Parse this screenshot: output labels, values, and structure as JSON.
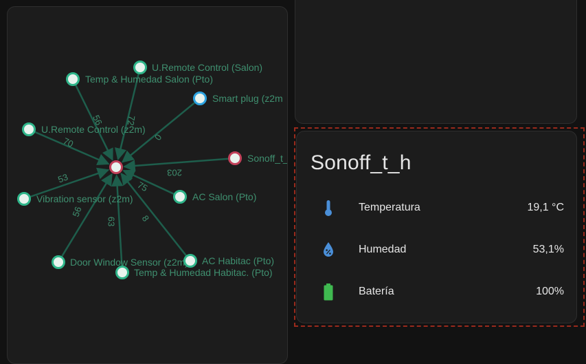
{
  "network_map": {
    "nodes": [
      {
        "id": "center",
        "label": "",
        "color": "#c2415a"
      },
      {
        "id": "u-remote-salon",
        "label": "U.Remote Control (Salon)",
        "color": "#2fb58a"
      },
      {
        "id": "temp-humedad-salon",
        "label": "Temp & Humedad Salon (Pto)",
        "color": "#2fb58a"
      },
      {
        "id": "smart-plug",
        "label": "Smart plug (z2m",
        "color": "#2da3e0"
      },
      {
        "id": "u-remote-z2m",
        "label": "U.Remote Control (z2m)",
        "color": "#2fb58a"
      },
      {
        "id": "sonoff",
        "label": "Sonoff_t_",
        "color": "#c2415a"
      },
      {
        "id": "vibration",
        "label": "Vibration sensor (z2m)",
        "color": "#2fb58a"
      },
      {
        "id": "ac-salon",
        "label": "AC Salon (Pto)",
        "color": "#2fb58a"
      },
      {
        "id": "door-window",
        "label": "Door Window Sensor (z2m)",
        "color": "#2fb58a"
      },
      {
        "id": "ac-habitac",
        "label": "AC Habitac (Pto)",
        "color": "#2fb58a"
      },
      {
        "id": "temp-humedad-habitac",
        "label": "Temp & Humedad Habitac. (Pto)",
        "color": "#2fb58a"
      }
    ],
    "edges": [
      {
        "from": "temp-humedad-salon",
        "label": "56"
      },
      {
        "from": "u-remote-salon",
        "label": "72"
      },
      {
        "from": "smart-plug",
        "label": "0"
      },
      {
        "from": "u-remote-z2m",
        "label": "70"
      },
      {
        "from": "sonoff",
        "label": "203"
      },
      {
        "from": "vibration",
        "label": "53"
      },
      {
        "from": "ac-salon",
        "label": "75"
      },
      {
        "from": "door-window",
        "label": "56"
      },
      {
        "from": "temp-humedad-habitac",
        "label": "63"
      },
      {
        "from": "ac-habitac",
        "label": "8"
      }
    ]
  },
  "sensor_card": {
    "title": "Sonoff_t_h",
    "rows": [
      {
        "icon": "thermometer-icon",
        "name": "Temperatura",
        "value": "19,1 °C",
        "icon_color": "#4a8fd8"
      },
      {
        "icon": "water-percent-icon",
        "name": "Humedad",
        "value": "53,1%",
        "icon_color": "#4a8fd8"
      },
      {
        "icon": "battery-icon",
        "name": "Batería",
        "value": "100%",
        "icon_color": "#3fb950"
      }
    ]
  },
  "colors": {
    "edge": "#1e5e4c",
    "selection_outline": "#9a2a1c"
  }
}
